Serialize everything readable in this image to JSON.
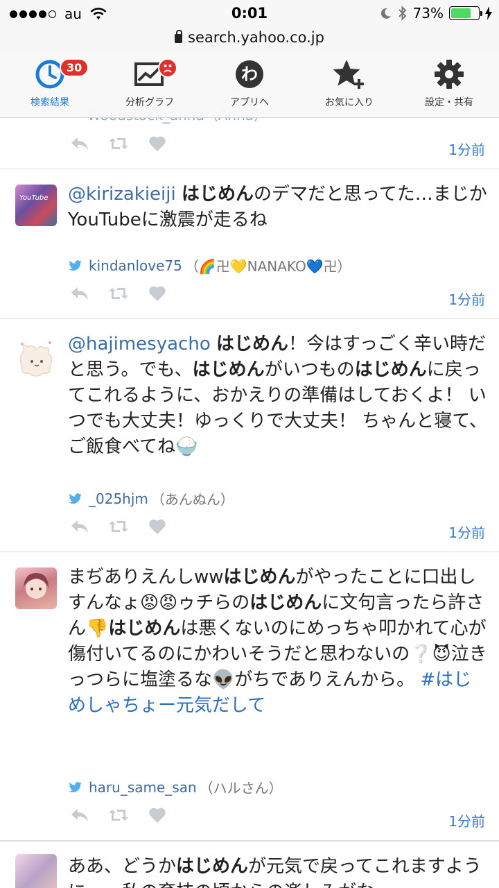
{
  "status_bar": {
    "carrier": "au",
    "time": "0:01",
    "battery": "73%",
    "battery_level": 0.73
  },
  "url": "search.yahoo.co.jp",
  "toolbar": [
    {
      "label": "検索結果",
      "badge": "30"
    },
    {
      "label": "分析グラフ"
    },
    {
      "label": "アプリへ"
    },
    {
      "label": "お気に入り"
    },
    {
      "label": "設定・共有"
    }
  ],
  "ghost_text": {
    "top": "hajimesyacho",
    "prev_user": "Woodstock_anna（Anna）"
  },
  "prev_time": "1分前",
  "tweets": [
    {
      "mention": "@kirizakieiji",
      "parts": [
        " ",
        "はじめん",
        "のデマだと思ってた…まじか YouTubeに激震が走るね"
      ],
      "username": "kindanlove75",
      "display_name": "（🌈卍💛NANAKO💙卍）",
      "time": "1分前"
    },
    {
      "mention": "@hajimesyacho",
      "parts": [
        " ",
        "はじめん",
        "！今はすっごく辛い時だと思う。でも、",
        "はじめん",
        "がいつもの",
        "はじめん",
        "に戻ってこれるように、おかえりの準備はしておくよ！ いつでも大丈夫！ゆっくりで大丈夫！ ちゃんと寝て、ご飯食べてね🍚"
      ],
      "username": "_025hjm",
      "display_name": "（あんぬん）",
      "time": "1分前"
    },
    {
      "parts": [
        "まぢありえんしww",
        "はじめん",
        "がやったことに口出しすんなょ😡😡ゥチらの",
        "はじめん",
        "に文句言ったら許さん👎",
        "はじめん",
        "は悪くないのにめっちゃ叩かれて心が傷付いてるのにかわいそうだと思わないの❔😈泣きっつらに塩塗るな👽がちでありえんから。 "
      ],
      "hashtag": "#はじめしゃちょー元気だして",
      "username": "haru_same_san",
      "display_name": "（ハルさん）",
      "time": "1分前"
    },
    {
      "parts": [
        "ああ、どうか",
        "はじめん",
        "が元気で戻ってこれます"
      ],
      "tail": "ように。。。私の育枝の頃からの楽しみがな"
    }
  ]
}
